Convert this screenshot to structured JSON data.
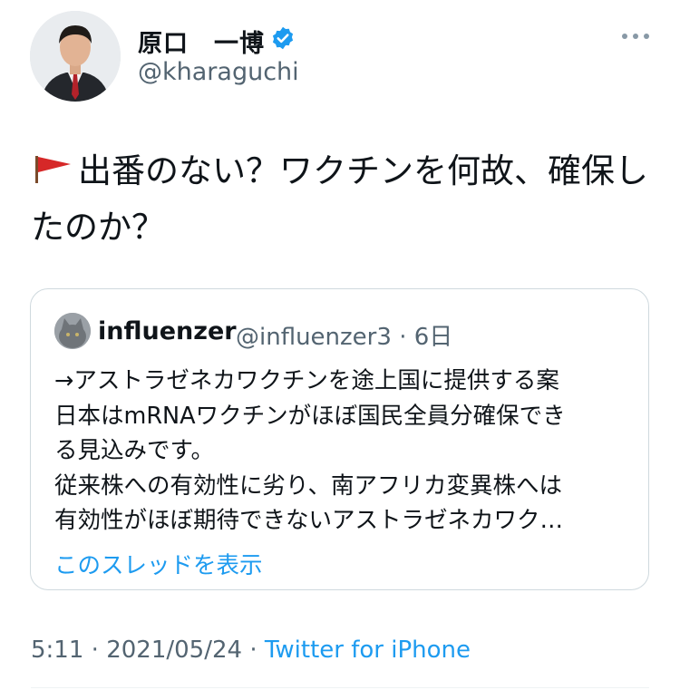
{
  "author": {
    "name": "原口　一博",
    "handle": "@kharaguchi",
    "verified": true,
    "verified_color": "#1d9bf0"
  },
  "tweet": {
    "text": "出番のない？ワクチンを何故、確保したのか？",
    "flag_icon": "red-triangular-flag-icon"
  },
  "quoted_tweet": {
    "name": "influenzer",
    "handle": "@influenzer3",
    "separator": "·",
    "time": "6日",
    "lines": [
      "→アストラゼネカワクチンを途上国に提供する案",
      "日本はmRNAワクチンがほぼ国民全員分確保でき",
      "る見込みです。",
      "従来株への有効性に劣り、南アフリカ変異株へは",
      "有効性がほぼ期待できないアストラゼネカワク…"
    ],
    "show_thread": "このスレッドを表示"
  },
  "meta": {
    "time": "5:11",
    "date": "2021/05/24",
    "separator": "·",
    "source": "Twitter for iPhone"
  },
  "colors": {
    "text": "#0f1419",
    "secondary": "#536471",
    "link": "#1d9bf0",
    "border": "#cfd9de"
  }
}
